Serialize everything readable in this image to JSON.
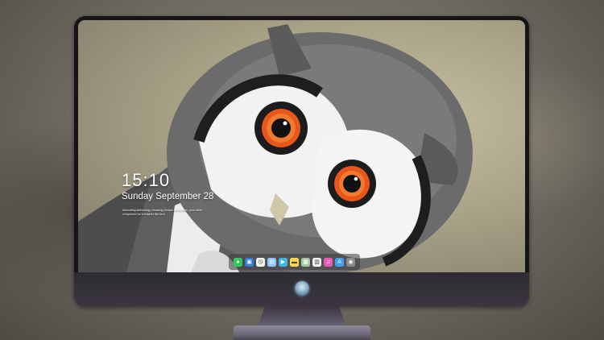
{
  "lockscreen": {
    "time": "15:10",
    "date": "Sunday September 28",
    "message": "Innovating technology, Amazing Unique Every Mac, your ideal companion for a smarter life here"
  },
  "dock": {
    "apps": [
      {
        "name": "messages-icon",
        "color": "#34c759",
        "glyph": "●"
      },
      {
        "name": "finder-icon",
        "color": "#2f7de1",
        "glyph": "▣"
      },
      {
        "name": "clock-icon",
        "color": "#f2f2f2",
        "glyph": "◷"
      },
      {
        "name": "photos-icon",
        "color": "#8ec5ff",
        "glyph": "▤"
      },
      {
        "name": "videos-icon",
        "color": "#3fb4e8",
        "glyph": "▶"
      },
      {
        "name": "notes-icon",
        "color": "#ffd84d",
        "glyph": "▬"
      },
      {
        "name": "preview-icon",
        "color": "#a6c9a0",
        "glyph": "▦"
      },
      {
        "name": "calendar-icon",
        "color": "#f5f5f5",
        "glyph": "▥"
      },
      {
        "name": "music-icon",
        "color": "#e85ab8",
        "glyph": "♫"
      },
      {
        "name": "app-store-icon",
        "color": "#3fa0f5",
        "glyph": "A"
      },
      {
        "name": "camera-icon",
        "color": "#8a8a8a",
        "glyph": "◉"
      }
    ]
  }
}
